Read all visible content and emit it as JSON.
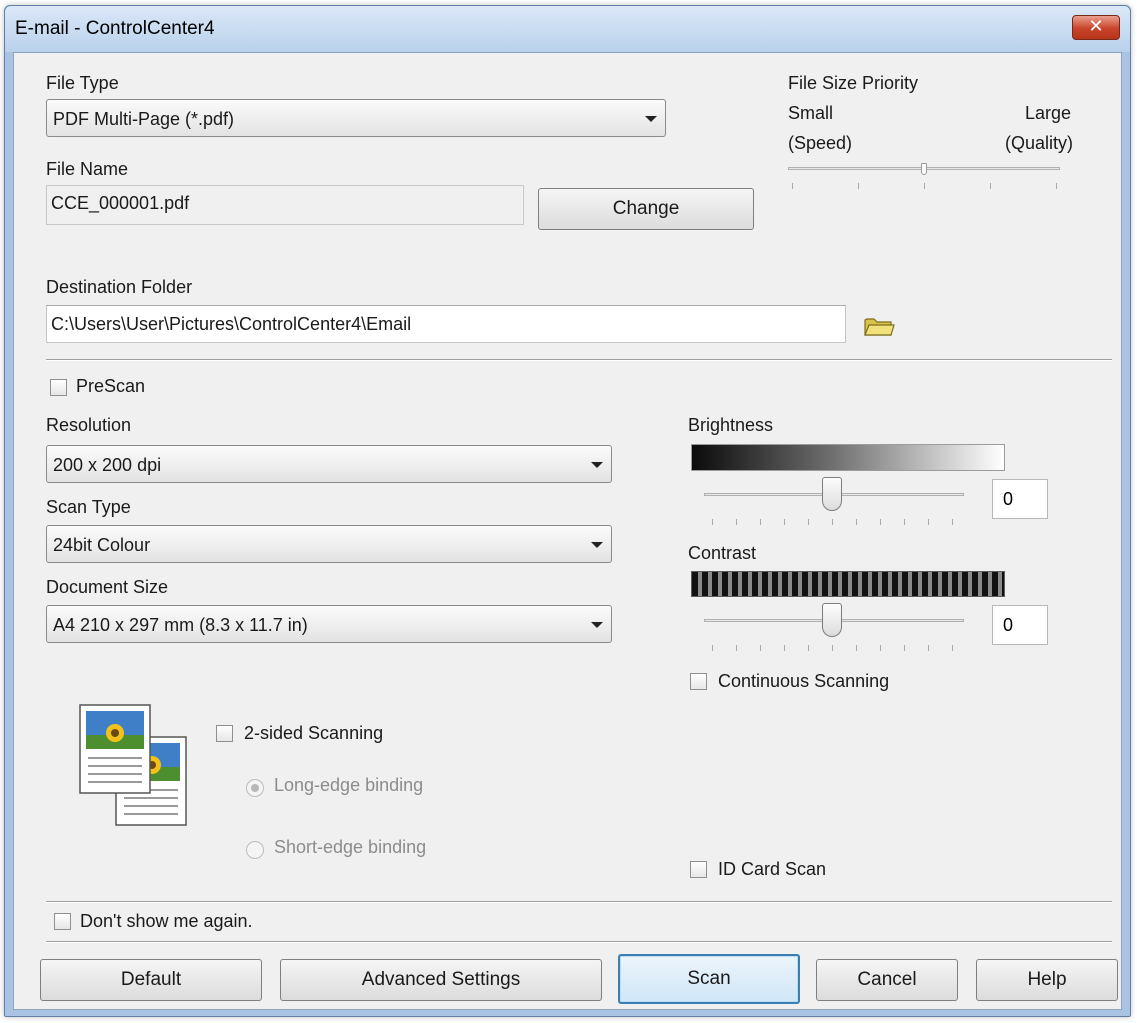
{
  "window": {
    "title": "E-mail - ControlCenter4",
    "close_label": "✕"
  },
  "file_type": {
    "label": "File Type",
    "value": "PDF Multi-Page (*.pdf)"
  },
  "file_name": {
    "label": "File Name",
    "value": "CCE_000001.pdf",
    "change_button": "Change"
  },
  "file_size_priority": {
    "label": "File Size Priority",
    "left_label": "Small",
    "left_sub": "(Speed)",
    "right_label": "Large",
    "right_sub": "(Quality)",
    "level_fraction": 0.5
  },
  "destination_folder": {
    "label": "Destination Folder",
    "value": "C:\\Users\\User\\Pictures\\ControlCenter4\\Email"
  },
  "prescan": {
    "label": "PreScan",
    "checked": false
  },
  "resolution": {
    "label": "Resolution",
    "value": "200 x 200 dpi"
  },
  "scan_type": {
    "label": "Scan Type",
    "value": "24bit Colour"
  },
  "document_size": {
    "label": "Document Size",
    "value": "A4 210 x 297 mm (8.3 x 11.7 in)"
  },
  "brightness": {
    "label": "Brightness",
    "value": "0"
  },
  "contrast": {
    "label": "Contrast",
    "value": "0"
  },
  "continuous_scanning": {
    "label": "Continuous Scanning",
    "checked": false
  },
  "two_sided": {
    "label": "2-sided Scanning",
    "checked": false,
    "long_edge_label": "Long-edge binding",
    "short_edge_label": "Short-edge binding",
    "selected": "long-edge"
  },
  "id_card_scan": {
    "label": "ID Card Scan",
    "checked": false
  },
  "dont_show": {
    "label": "Don't show me again.",
    "checked": false
  },
  "buttons": {
    "default": "Default",
    "advanced": "Advanced Settings",
    "scan": "Scan",
    "cancel": "Cancel",
    "help": "Help"
  },
  "colors": {
    "title_bar": "#b9d1ec",
    "close_button": "#c8432a",
    "default_button_border": "#3c7fb1"
  }
}
